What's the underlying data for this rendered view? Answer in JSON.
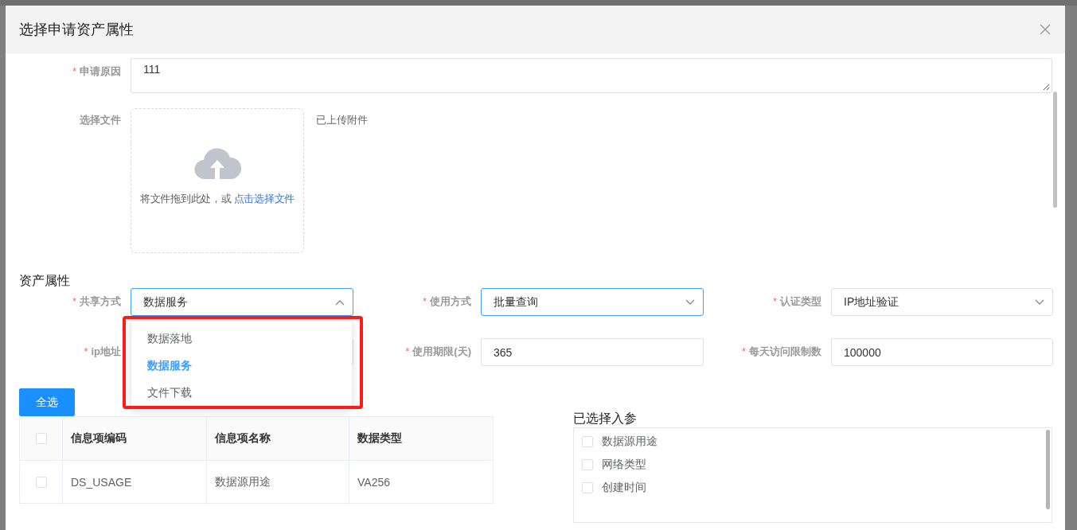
{
  "dialog": {
    "title": "选择申请资产属性"
  },
  "required_mark": "*",
  "reason": {
    "label": "申请原因",
    "required": true,
    "value": "111"
  },
  "upload": {
    "label": "选择文件",
    "drag_text": "将文件拖到此处，或",
    "link_text": "点击选择文件",
    "uploaded_label": "已上传附件"
  },
  "section_title": "资产属性",
  "fields": [
    {
      "label": "共享方式",
      "required": true,
      "kind": "select",
      "value": "数据服务",
      "expanded": true,
      "options": [
        {
          "label": "数据落地",
          "selected": false
        },
        {
          "label": "数据服务",
          "selected": true
        },
        {
          "label": "文件下载",
          "selected": false
        }
      ]
    },
    {
      "label": "使用方式",
      "required": true,
      "kind": "select",
      "value": "批量查询",
      "expanded": false
    },
    {
      "label": "认证类型",
      "required": true,
      "kind": "select",
      "value": "IP地址验证",
      "expanded": false
    },
    {
      "label": "ip地址",
      "required": true,
      "kind": "input"
    },
    {
      "label": "使用期限(天)",
      "required": true,
      "kind": "input",
      "value": "365"
    },
    {
      "label": "每天访问限制数",
      "required": true,
      "kind": "input",
      "value": "100000"
    }
  ],
  "select_all_button": "全选",
  "table": {
    "header_checked": false,
    "columns": [
      "信息项编码",
      "信息项名称",
      "数据类型"
    ],
    "rows": [
      {
        "checked": false,
        "cells": [
          "DS_USAGE",
          "数据源用途",
          "VA256"
        ]
      }
    ]
  },
  "selected_params": {
    "title": "已选择入参",
    "items": [
      {
        "label": "数据源用途",
        "checked": false
      },
      {
        "label": "网络类型",
        "checked": false
      },
      {
        "label": "创建时间",
        "checked": false
      }
    ]
  }
}
